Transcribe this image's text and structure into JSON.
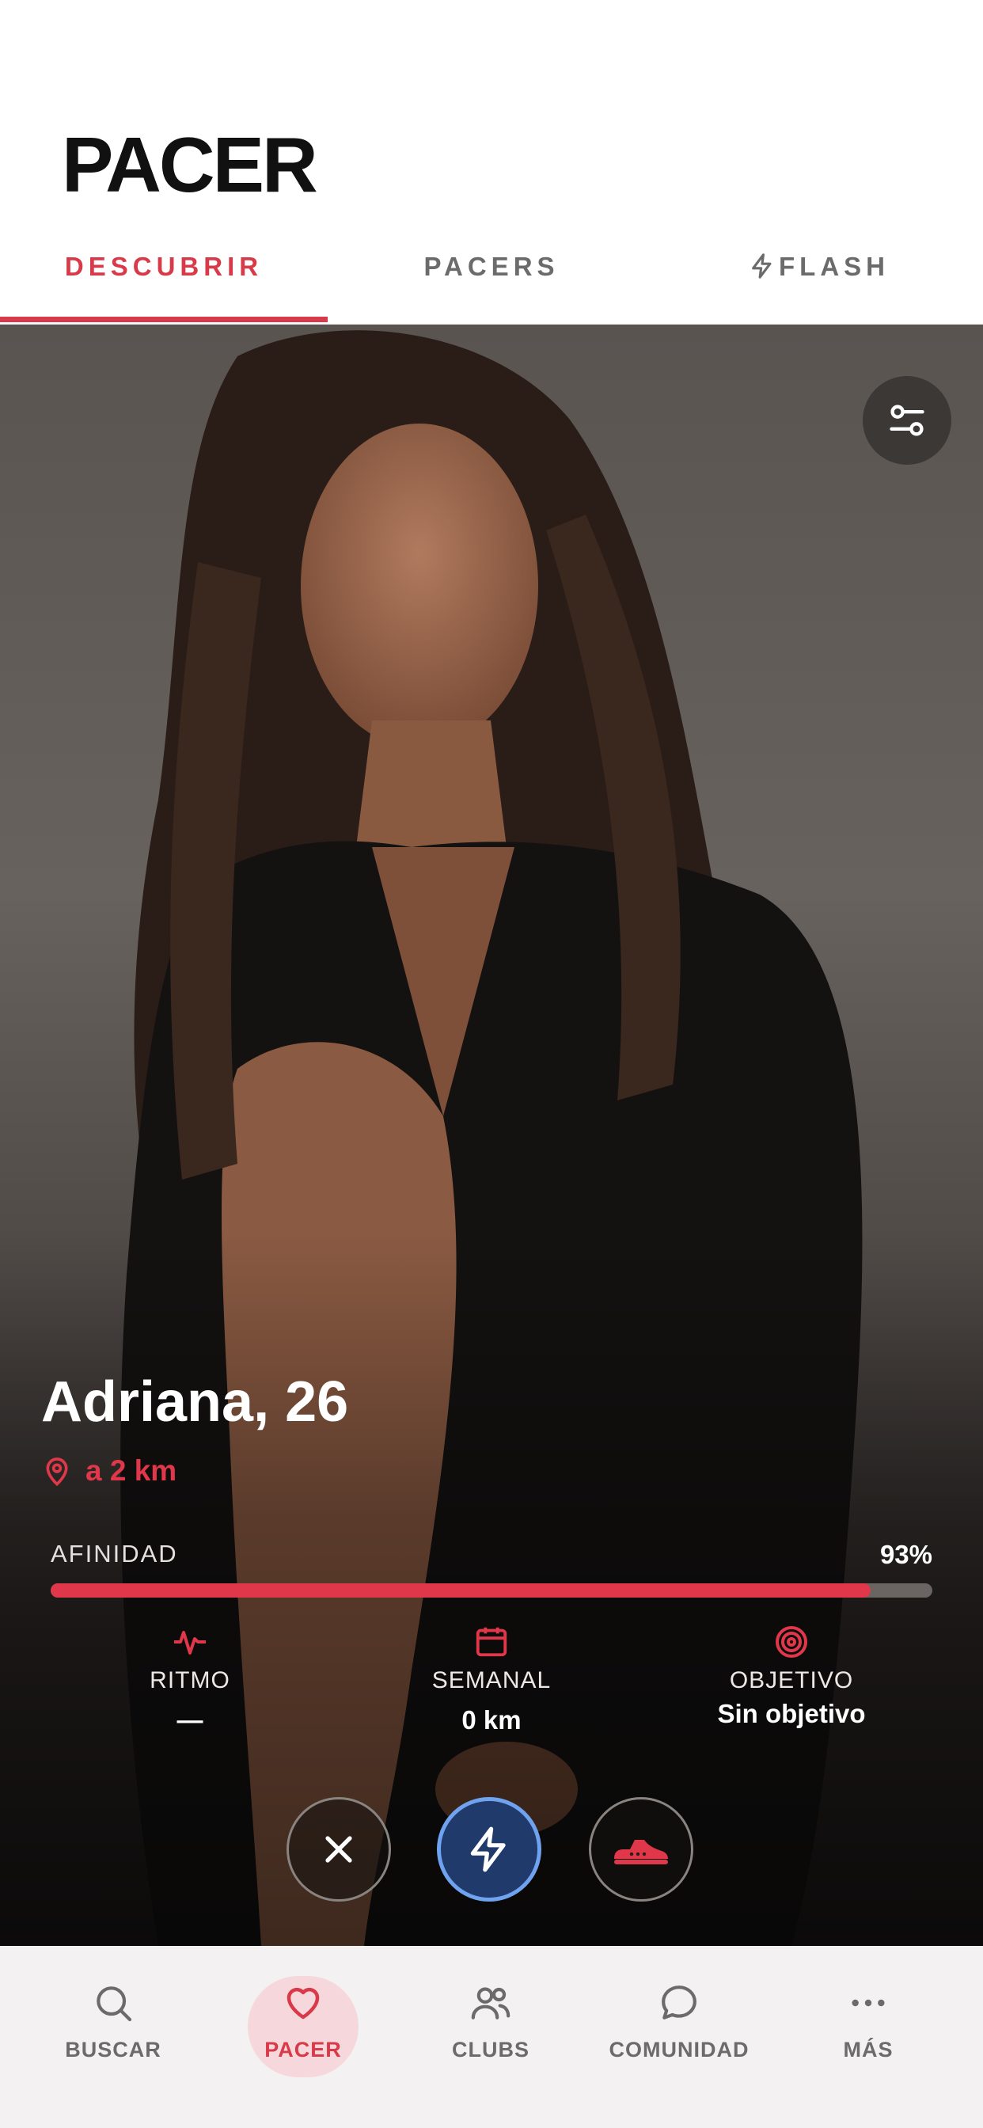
{
  "app": {
    "title": "PACER"
  },
  "tabs": [
    {
      "label": "DESCUBRIR",
      "active": true
    },
    {
      "label": "PACERS",
      "active": false
    },
    {
      "label": "FLASH",
      "active": false
    }
  ],
  "profile": {
    "name_age": "Adriana, 26",
    "distance": "a 2 km",
    "affinity": {
      "label": "AFINIDAD",
      "value_text": "93%",
      "fraction": 0.93
    },
    "stats": [
      {
        "icon": "pulse-icon",
        "label": "RITMO",
        "value": "—"
      },
      {
        "icon": "calendar-icon",
        "label": "SEMANAL",
        "value": "0 km"
      },
      {
        "icon": "target-icon",
        "label": "OBJETIVO",
        "value": "Sin objetivo"
      }
    ]
  },
  "actions": [
    "close-icon",
    "flash-icon",
    "running-shoe-icon"
  ],
  "bottom_nav": [
    {
      "label": "BUSCAR",
      "icon": "search-icon",
      "active": false
    },
    {
      "label": "PACER",
      "icon": "heart-icon",
      "active": true
    },
    {
      "label": "CLUBS",
      "icon": "users-icon",
      "active": false
    },
    {
      "label": "COMUNIDAD",
      "icon": "chat-bubble-icon",
      "active": false
    },
    {
      "label": "MÁS",
      "icon": "more-dots-icon",
      "active": false
    }
  ],
  "colors": {
    "accent": "#d93a4a",
    "flash_blue": "#203a6b",
    "flash_ring": "#6fa3f0"
  }
}
